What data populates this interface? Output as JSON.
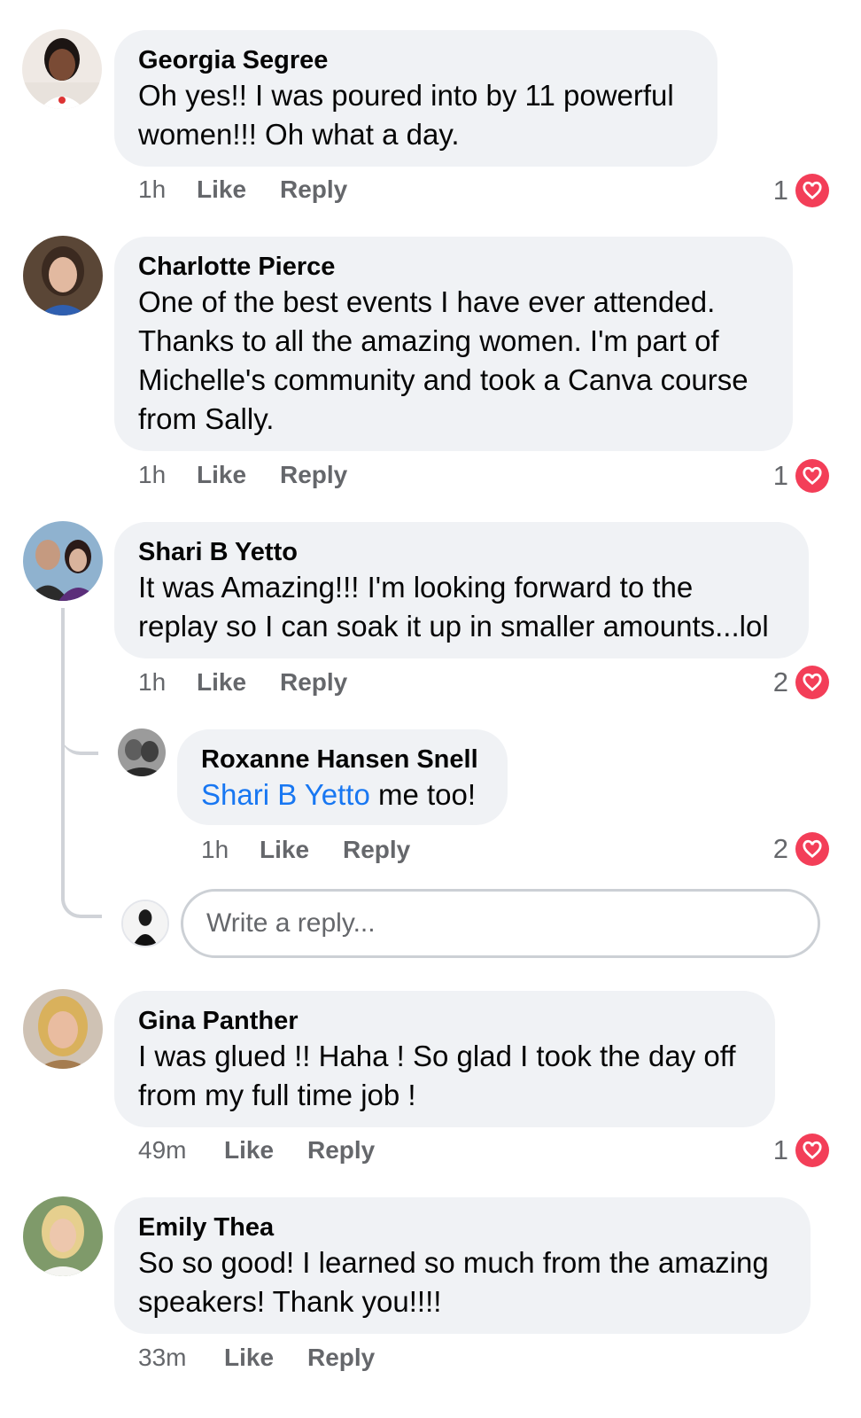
{
  "comments": [
    {
      "name": "Georgia Segree",
      "lines": [
        "Oh yes!!  I was poured into by 11 powerful",
        "women!!!  Oh what a day."
      ],
      "time": "1h",
      "like": "Like",
      "reply": "Reply",
      "reactions": "1"
    },
    {
      "name": "Charlotte Pierce",
      "lines": [
        "One of the best events I have ever attended.",
        "Thanks to all the amazing women.  I'm part of",
        "Michelle's community and took a Canva course",
        "from Sally."
      ],
      "time": "1h",
      "like": "Like",
      "reply": "Reply",
      "reactions": "1"
    },
    {
      "name": "Shari B Yetto",
      "lines": [
        "It was Amazing!!! I'm looking forward to the",
        "replay so I can soak it up in smaller amounts...lol"
      ],
      "time": "1h",
      "like": "Like",
      "reply": "Reply",
      "reactions": "2",
      "replies": [
        {
          "name": "Roxanne Hansen Snell",
          "mention": "Shari B Yetto",
          "text": " me too!",
          "time": "1h",
          "like": "Like",
          "reply": "Reply",
          "reactions": "2"
        }
      ]
    },
    {
      "name": "Gina Panther",
      "lines": [
        "I was glued !! Haha ! So glad I took the day off",
        "from my full time job !"
      ],
      "time": "49m",
      "like": "Like",
      "reply": "Reply",
      "reactions": "1"
    },
    {
      "name": "Emily Thea",
      "lines": [
        "So so good! I learned so much from the amazing",
        "speakers! Thank you!!!!"
      ],
      "time": "33m",
      "like": "Like",
      "reply": "Reply"
    }
  ],
  "reply_input": {
    "placeholder": "Write a reply..."
  },
  "colors": {
    "bubble": "#f0f2f5",
    "meta": "#65676b",
    "mention": "#1877f2",
    "love": "#f33e58"
  },
  "icons": {
    "reaction": "love-heart-icon"
  }
}
